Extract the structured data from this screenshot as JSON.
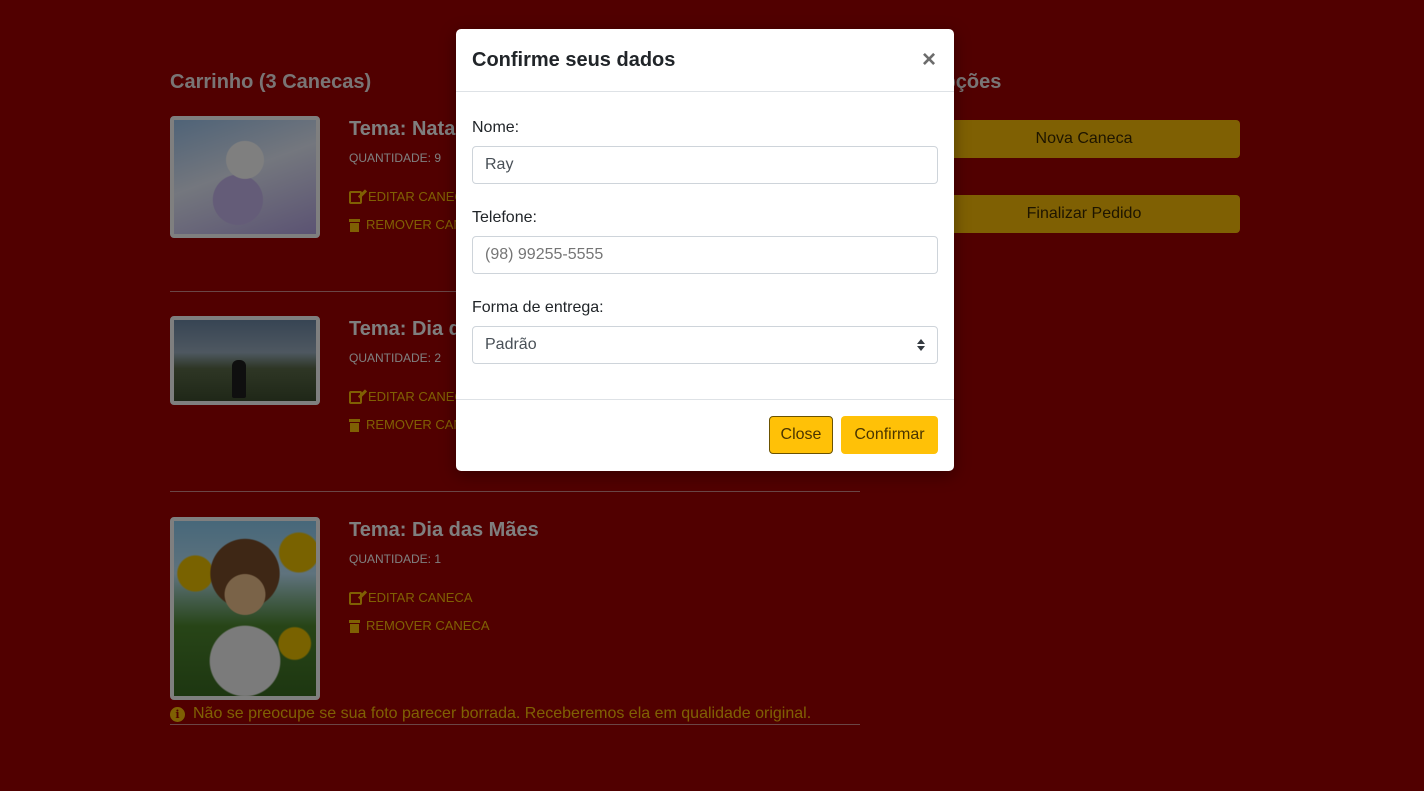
{
  "cart": {
    "title": "Carrinho (3 Canecas)",
    "items": [
      {
        "theme": "Tema: Natal",
        "quantity": "QUANTIDADE: 9",
        "edit_label": "EDITAR CANECA",
        "remove_label": "REMOVER CANECA"
      },
      {
        "theme": "Tema: Dia dos Pais",
        "quantity": "QUANTIDADE: 2",
        "edit_label": "EDITAR CANECA",
        "remove_label": "REMOVER CANECA"
      },
      {
        "theme": "Tema: Dia das Mães",
        "quantity": "QUANTIDADE: 1",
        "edit_label": "EDITAR CANECA",
        "remove_label": "REMOVER CANECA"
      }
    ],
    "notice": "Não se preocupe se sua foto parecer borrada. Receberemos ela em qualidade original."
  },
  "options": {
    "title": "Opções",
    "new_mug_label": "Nova Caneca",
    "finish_label": "Finalizar Pedido"
  },
  "modal": {
    "title": "Confirme seus dados",
    "close_symbol": "×",
    "name_label": "Nome:",
    "name_value": "Ray",
    "phone_label": "Telefone:",
    "phone_placeholder": "(98) 99255-5555",
    "delivery_label": "Forma de entrega:",
    "delivery_selected": "Padrão",
    "close_button": "Close",
    "confirm_button": "Confirmar"
  },
  "colors": {
    "background": "#a30000",
    "accent": "#ffc107"
  }
}
